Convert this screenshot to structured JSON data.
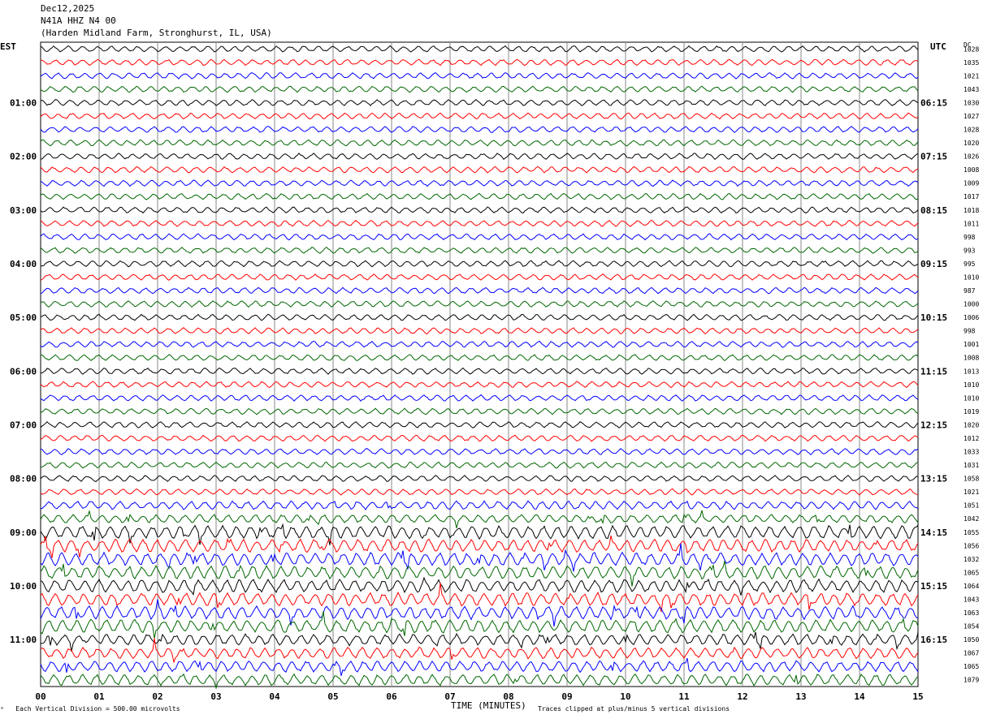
{
  "header": {
    "date": "Dec12,2025",
    "station": "N41A HHZ N4 00",
    "location": "(Harden Midland Farm, Stronghurst, IL, USA)"
  },
  "left_axis_label": "EST",
  "right_axis_label": "UTC",
  "dc_label": "DC",
  "left_hour_labels": [
    "01:00",
    "02:00",
    "03:00",
    "04:00",
    "05:00",
    "06:00",
    "07:00",
    "08:00",
    "09:00",
    "10:00",
    "11:00"
  ],
  "right_hour_labels": [
    "06:15",
    "07:15",
    "08:15",
    "09:15",
    "10:15",
    "11:15",
    "12:15",
    "13:15",
    "14:15",
    "15:15",
    "16:15"
  ],
  "footer": {
    "scale_note": "Each Vertical Division =  500.00 microvolts",
    "x_axis_title": "TIME (MINUTES)",
    "clip_note": "Traces clipped at plus/minus 5 vertical divisions"
  },
  "colors": {
    "trace_cycle": [
      "#000000",
      "#ff0000",
      "#0000ff",
      "#006600"
    ],
    "grid": "#888888"
  },
  "chart_data": {
    "type": "helicorder",
    "x_ticks": [
      "00",
      "01",
      "02",
      "03",
      "04",
      "05",
      "06",
      "07",
      "08",
      "09",
      "10",
      "11",
      "12",
      "13",
      "14",
      "15"
    ],
    "xlim": [
      0,
      15
    ],
    "trace_count": 48,
    "traces_per_hour": 4,
    "dc_offsets": [
      1028,
      1035,
      1021,
      1043,
      1030,
      1027,
      1028,
      1020,
      1026,
      1008,
      1009,
      1017,
      1018,
      1011,
      998,
      993,
      995,
      1010,
      987,
      1000,
      1006,
      998,
      1001,
      1008,
      1013,
      1010,
      1010,
      1019,
      1020,
      1012,
      1033,
      1031,
      1058,
      1021,
      1051,
      1042,
      1055,
      1056,
      1032,
      1065,
      1064,
      1043,
      1063,
      1054,
      1050,
      1067,
      1065,
      1079
    ]
  }
}
